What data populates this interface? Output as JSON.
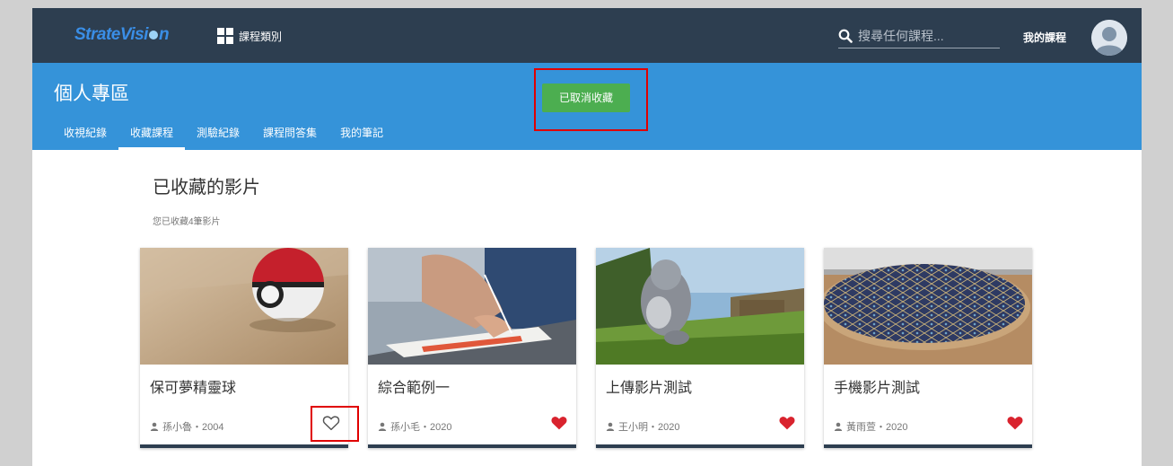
{
  "header": {
    "logo_text": "StrateVision",
    "category_label": "課程類別",
    "search_placeholder": "搜尋任何課程...",
    "my_courses_label": "我的課程"
  },
  "section": {
    "page_title": "個人專區",
    "tabs": [
      "收視紀錄",
      "收藏課程",
      "測驗紀錄",
      "課程問答集",
      "我的筆記"
    ],
    "active_tab": "收藏課程",
    "toast": "已取消收藏"
  },
  "favorites": {
    "title": "已收藏的影片",
    "subtitle": "您已收藏4筆影片",
    "cards": [
      {
        "title": "保可夢精靈球",
        "meta": "孫小魯・2004",
        "favorited": false
      },
      {
        "title": "綜合範例一",
        "meta": "孫小毛・2020",
        "favorited": true
      },
      {
        "title": "上傳影片測試",
        "meta": "王小明・2020",
        "favorited": true
      },
      {
        "title": "手機影片測試",
        "meta": "黃雨萱・2020",
        "favorited": true
      }
    ]
  },
  "colors": {
    "topbar": "#2d3e50",
    "banner": "#3593d9",
    "toast": "#4cae50",
    "heart": "#d9232e",
    "highlight": "#e00000"
  }
}
